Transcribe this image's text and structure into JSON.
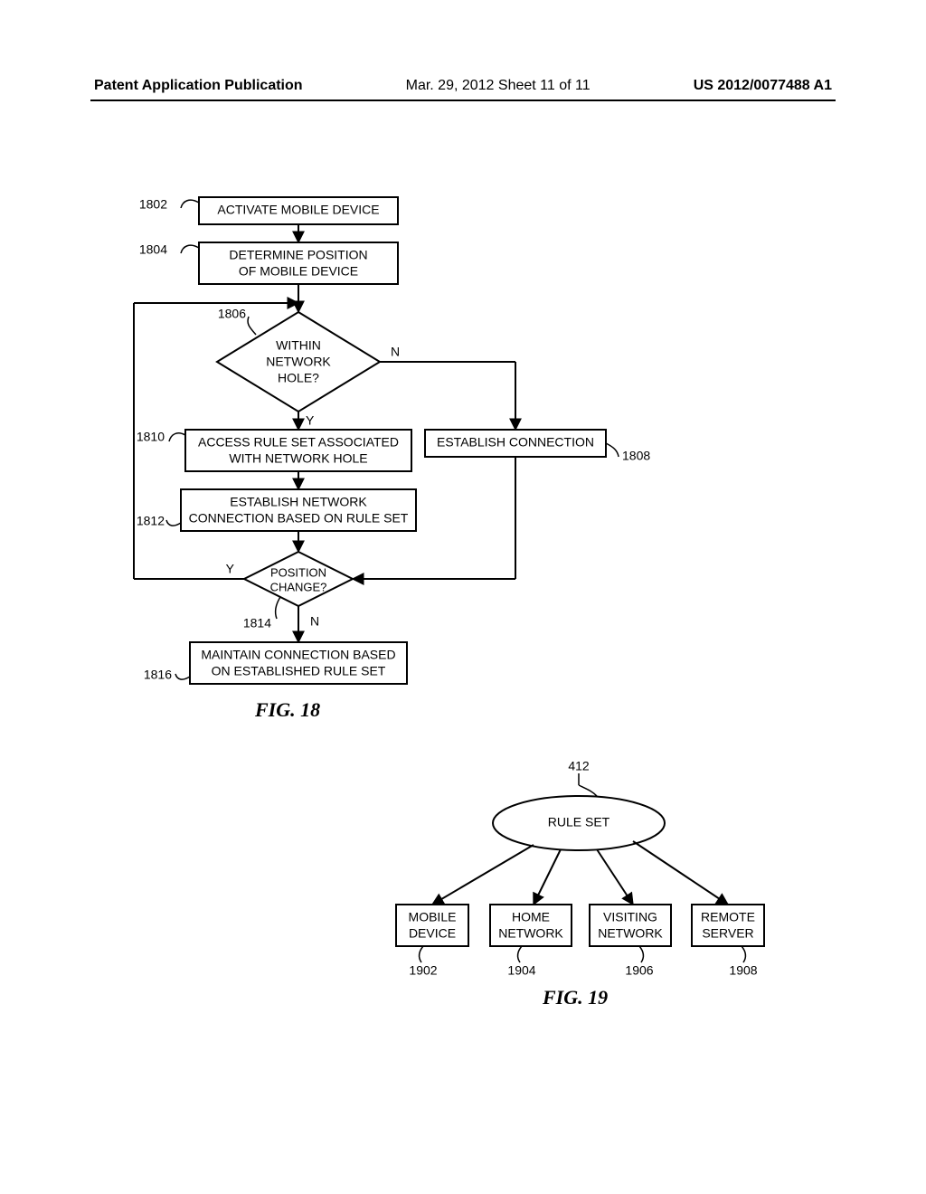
{
  "header": {
    "left": "Patent Application Publication",
    "center": "Mar. 29, 2012  Sheet 11 of 11",
    "right": "US 2012/0077488 A1"
  },
  "fig18": {
    "caption": "FIG. 18",
    "nodes": {
      "n1802": {
        "ref": "1802",
        "text": "ACTIVATE MOBILE DEVICE"
      },
      "n1804": {
        "ref": "1804",
        "text1": "DETERMINE POSITION",
        "text2": "OF MOBILE DEVICE"
      },
      "n1806": {
        "ref": "1806",
        "text1": "WITHIN",
        "text2": "NETWORK",
        "text3": "HOLE?",
        "yes": "Y",
        "no": "N"
      },
      "n1808": {
        "ref": "1808",
        "text": "ESTABLISH  CONNECTION"
      },
      "n1810": {
        "ref": "1810",
        "text1": "ACCESS RULE SET ASSOCIATED",
        "text2": "WITH NETWORK HOLE"
      },
      "n1812": {
        "ref": "1812",
        "text1": "ESTABLISH NETWORK",
        "text2": "CONNECTION BASED ON RULE SET"
      },
      "n1814": {
        "ref": "1814",
        "text1": "POSITION",
        "text2": "CHANGE?",
        "yes": "Y",
        "no": "N"
      },
      "n1816": {
        "ref": "1816",
        "text1": "MAINTAIN CONNECTION BASED",
        "text2": "ON ESTABLISHED RULE SET"
      }
    }
  },
  "fig19": {
    "caption": "FIG. 19",
    "nodes": {
      "n412": {
        "ref": "412",
        "text": "RULE SET"
      },
      "n1902": {
        "ref": "1902",
        "text1": "MOBILE",
        "text2": "DEVICE"
      },
      "n1904": {
        "ref": "1904",
        "text1": "HOME",
        "text2": "NETWORK"
      },
      "n1906": {
        "ref": "1906",
        "text1": "VISITING",
        "text2": "NETWORK"
      },
      "n1908": {
        "ref": "1908",
        "text1": "REMOTE",
        "text2": "SERVER"
      }
    }
  }
}
